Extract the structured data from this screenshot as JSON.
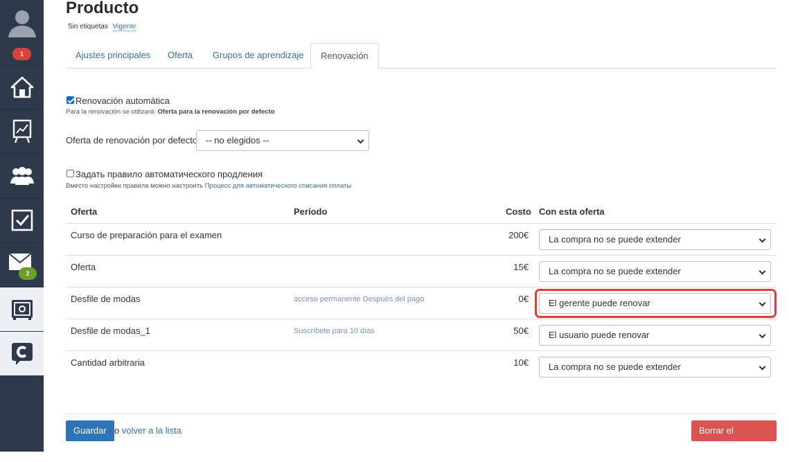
{
  "sidebar": {
    "notifications_badge": "1",
    "messages_badge": "2",
    "items": [
      {
        "name": "home",
        "icon": "home-icon"
      },
      {
        "name": "stats",
        "icon": "chart-board-icon"
      },
      {
        "name": "users",
        "icon": "users-icon"
      },
      {
        "name": "tasks",
        "icon": "checkbox-icon"
      },
      {
        "name": "messages",
        "icon": "mail-icon"
      },
      {
        "name": "products",
        "icon": "safe-icon"
      },
      {
        "name": "brand",
        "icon": "brand-logo-icon"
      }
    ],
    "colors": {
      "bg": "#2e3a4c",
      "badge_red": "#d9423a",
      "badge_green": "#6a9f2a"
    }
  },
  "page": {
    "title": "Producto",
    "tags_label": "Sin etiquetas",
    "status_link": "Vigente"
  },
  "tabs": [
    {
      "label": "Ajustes principales",
      "active": false
    },
    {
      "label": "Oferta",
      "active": false
    },
    {
      "label": "Grupos de aprendizaje",
      "active": false
    },
    {
      "label": "Renovación",
      "active": true
    }
  ],
  "auto_renewal": {
    "checked": true,
    "label": "Renovación automática",
    "hint_prefix": "Para la renovación se utilizará:",
    "hint_value": "Oferta para la renovación por defecto"
  },
  "default_offer": {
    "label": "Oferta de renovación por defecto:",
    "selected": "-- no elegidos --"
  },
  "auto_extend_rule": {
    "checked": false,
    "label": "Задать правило автоматического продления",
    "hint_prefix": "Вместо настройки правила можно настроить",
    "hint_link": "Процесс для автоматического списания оплаты"
  },
  "table": {
    "headers": {
      "offer": "Oferta",
      "period": "Período",
      "cost": "Costo",
      "with_offer": "Con esta oferta"
    },
    "rows": [
      {
        "offer": "Curso de preparación para el examen",
        "period": "",
        "cost": "200€",
        "option": "La compra no se puede extender"
      },
      {
        "offer": "Oferta",
        "period": "",
        "cost": "15€",
        "option": "La compra no se puede extender"
      },
      {
        "offer": "Desfile de modas",
        "period": "acceso permanente Después del pago",
        "cost": "0€",
        "option": "El gerente puede renovar"
      },
      {
        "offer": "Desfile de modas_1",
        "period": "Suscríbete para 10 días",
        "cost": "50€",
        "option": "El usuario puede renovar"
      },
      {
        "offer": "Cantidad arbitraria",
        "period": "",
        "cost": "10€",
        "option": "La compra no se puede extender"
      }
    ]
  },
  "footer": {
    "save_label": "Guardar",
    "or_text": "o",
    "back_link": "volver a la lista",
    "delete_label": "Borrar el producto"
  }
}
